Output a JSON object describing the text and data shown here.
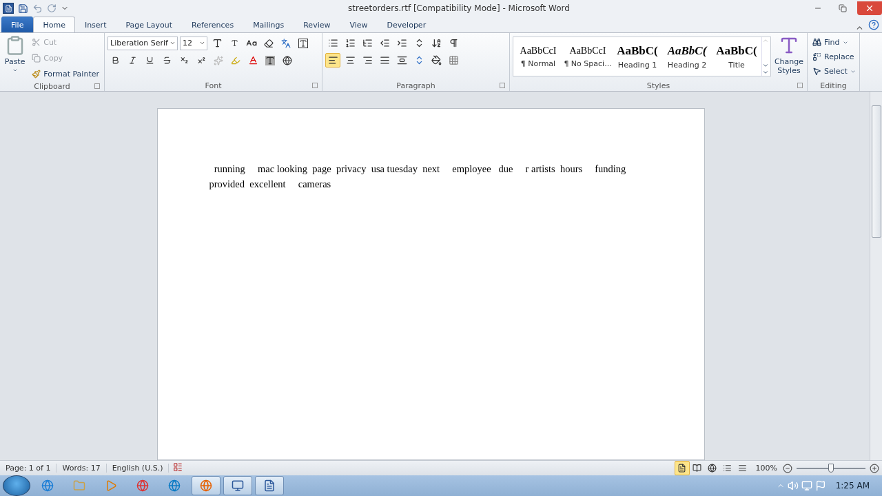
{
  "window": {
    "title": "streetorders.rtf [Compatibility Mode] - Microsoft Word"
  },
  "tabs": [
    {
      "label": "File",
      "kind": "file",
      "selected": false
    },
    {
      "label": "Home",
      "kind": "tab",
      "selected": true
    },
    {
      "label": "Insert",
      "kind": "tab",
      "selected": false
    },
    {
      "label": "Page Layout",
      "kind": "tab",
      "selected": false
    },
    {
      "label": "References",
      "kind": "tab",
      "selected": false
    },
    {
      "label": "Mailings",
      "kind": "tab",
      "selected": false
    },
    {
      "label": "Review",
      "kind": "tab",
      "selected": false
    },
    {
      "label": "View",
      "kind": "tab",
      "selected": false
    },
    {
      "label": "Developer",
      "kind": "tab",
      "selected": false
    }
  ],
  "clipboard": {
    "label": "Clipboard",
    "paste": "Paste",
    "cut": {
      "label": "Cut",
      "disabled": true
    },
    "copy": {
      "label": "Copy",
      "disabled": true
    },
    "format_painter": {
      "label": "Format Painter",
      "disabled": false
    }
  },
  "font": {
    "label": "Font",
    "font_name": "Liberation Serif",
    "font_size": "12"
  },
  "paragraph": {
    "label": "Paragraph",
    "alignments": [
      {
        "selected": true
      },
      {
        "selected": false
      },
      {
        "selected": false
      },
      {
        "selected": false
      },
      {
        "selected": false
      }
    ]
  },
  "styles": {
    "label": "Styles",
    "items": [
      {
        "preview": "AaBbCcI",
        "name": "¶ Normal",
        "kind": "normal"
      },
      {
        "preview": "AaBbCcI",
        "name": "¶ No Spaci...",
        "kind": "normal"
      },
      {
        "preview": "AaBbC(",
        "name": "Heading 1",
        "kind": "heading1"
      },
      {
        "preview": "AaBbC(",
        "name": "Heading 2",
        "kind": "heading2"
      },
      {
        "preview": "AaBbC(",
        "name": "Title",
        "kind": "title"
      }
    ],
    "change_styles": "Change Styles"
  },
  "editing": {
    "label": "Editing",
    "find": "Find",
    "replace": "Replace",
    "select": "Select"
  },
  "document": {
    "text": "  running     mac looking  page  privacy  usa tuesday  next     employee   due     r artists  hours     funding  provided  excellent     cameras"
  },
  "status_bar": {
    "page": "Page: 1 of 1",
    "words": "Words: 17",
    "language": "English (U.S.)",
    "zoom": "100%",
    "zoom_slider": {
      "level": 0.5
    }
  },
  "taskbar": {
    "clock": "1:25 AM"
  }
}
